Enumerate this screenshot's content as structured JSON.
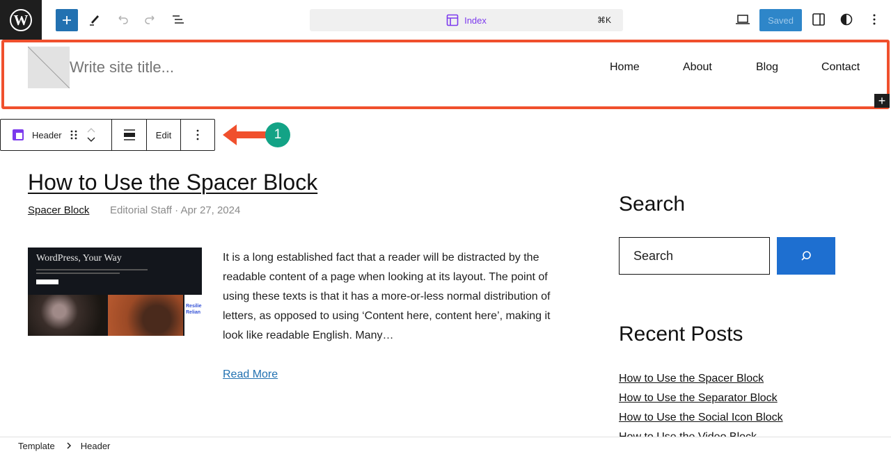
{
  "topbar": {
    "logo": "wordpress-logo",
    "icons": [
      "plus-icon",
      "pencil-icon",
      "undo-icon",
      "redo-icon",
      "list-view-icon"
    ],
    "command": {
      "title": "Index",
      "shortcut": "⌘K",
      "icon": "template-layout-icon"
    },
    "saved_label": "Saved",
    "right_icons": [
      "desktop-view-icon",
      "sidebar-toggle-icon",
      "styles-icon",
      "more-vertical-icon"
    ]
  },
  "header": {
    "site_title_placeholder": "Write site title...",
    "nav": [
      "Home",
      "About",
      "Blog",
      "Contact"
    ]
  },
  "block_toolbar": {
    "block_name": "Header",
    "edit_label": "Edit"
  },
  "annotation": {
    "badge": "1",
    "color": "#f0502d",
    "badge_color": "#13a386"
  },
  "post": {
    "title": "How to Use the Spacer Block",
    "category": "Spacer Block",
    "meta": "Editorial Staff · Apr 27, 2024",
    "thumbnail": {
      "heading": "WordPress, Your Way",
      "side_text": "Resilie Relian"
    },
    "excerpt": "It is a long established fact that a reader will be distracted by the readable content of a page when looking at its layout. The point of using these texts is that it has a more-or-less normal distribution of letters, as opposed to using ‘Content here, content here’, making it look like readable English. Many…",
    "read_more": "Read More"
  },
  "sidebar": {
    "search_heading": "Search",
    "search_placeholder": "Search",
    "recent_heading": "Recent Posts",
    "recent_posts": [
      "How to Use the Spacer Block",
      "How to Use the Separator Block",
      "How to Use the Social Icon Block",
      "How to Use the Video Block"
    ]
  },
  "breadcrumb": [
    "Template",
    "Header"
  ]
}
